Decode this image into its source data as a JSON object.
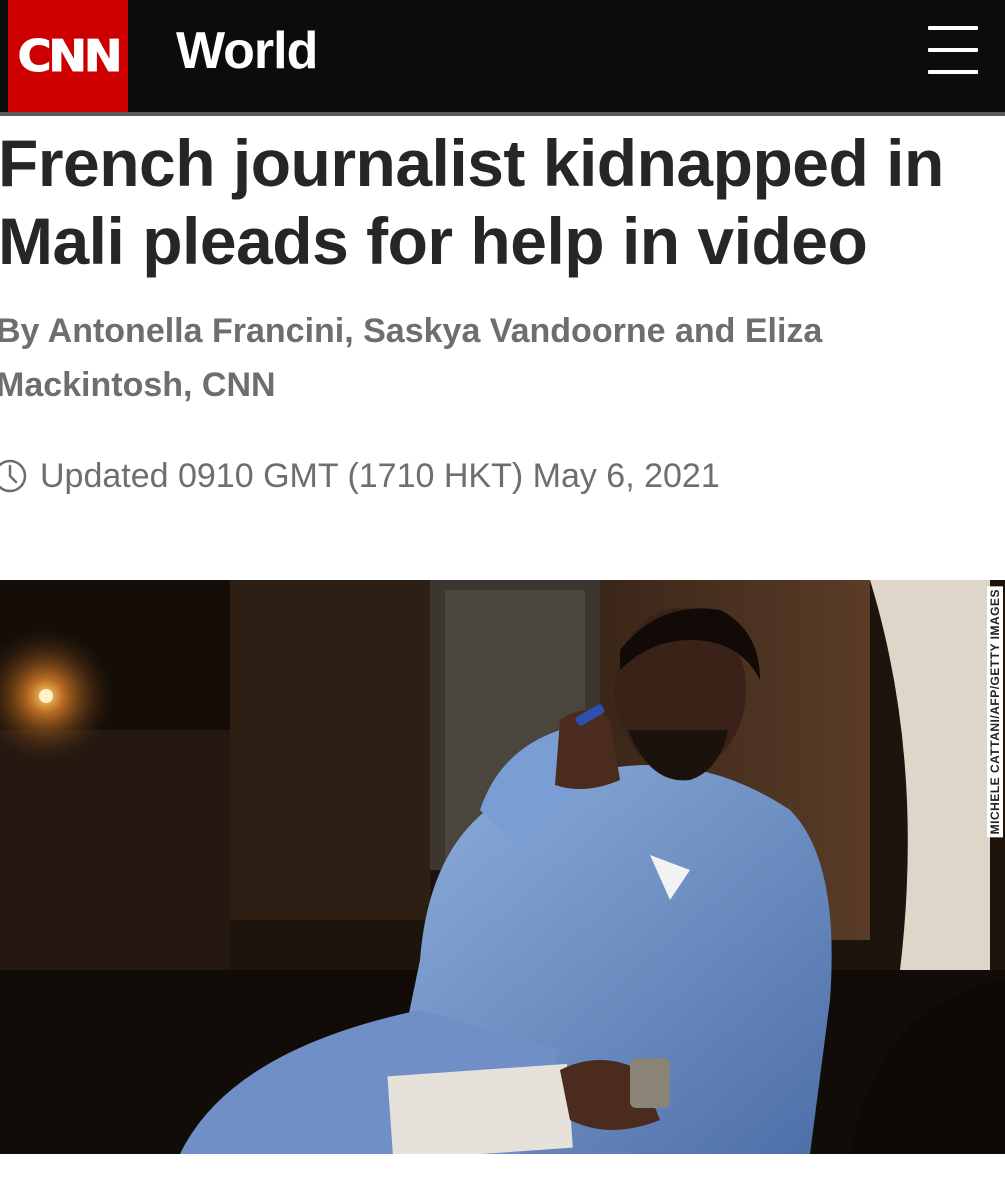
{
  "header": {
    "logo_text": "CNN",
    "section": "World",
    "menu_icon": "hamburger-menu-icon",
    "colors": {
      "bar": "#0c0c0c",
      "logo": "#cc0000"
    }
  },
  "article": {
    "headline_line1": "French journalist kidnapped in",
    "headline_line2": "Mali pleads for help in video",
    "byline_line1": "By Antonella Francini, Saskya Vandoorne and Eliza",
    "byline_line2": "Mackintosh, CNN",
    "timestamp": "Updated 0910 GMT (1710 HKT) May 6, 2021",
    "timestamp_icon": "clock-icon"
  },
  "photo": {
    "credit": "MICHELE CATTANI/AFP/GETTY IMAGES"
  }
}
